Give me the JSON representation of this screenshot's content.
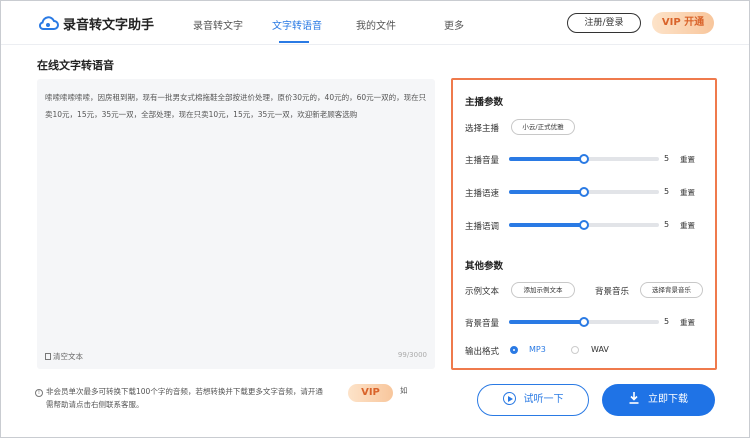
{
  "header": {
    "app_title": "录音转文字助手",
    "nav": [
      {
        "label": "录音转文字",
        "active": false
      },
      {
        "label": "文字转语音",
        "active": true
      },
      {
        "label": "我的文件",
        "active": false
      },
      {
        "label": "更多",
        "active": false
      }
    ],
    "login_label": "注册/登录",
    "vip_label": "VIP 开通"
  },
  "editor": {
    "section_title": "在线文字转语音",
    "text": "嗦嗦嗦嗦嗦嗦，因房租到期，现有一批男女式棉拖鞋全部按进价处理，原价30元的，40元的，60元一双的，现在只卖10元，15元，35元一双，全部处理，现在只卖10元，15元，35元一双，欢迎新老顾客选购",
    "clear_label": "清空文本",
    "char_count": "99/3000"
  },
  "notice": {
    "text": "非会员单次最多可转换下载100个字的音频，若想转换并下载更多文字音频，请开通",
    "vip_label": "VIP",
    "tail_1": "如",
    "line2": "需帮助请点击右侧联系客服。"
  },
  "panel": {
    "anchor_heading": "主播参数",
    "select_anchor_label": "选择主播",
    "anchor_value": "小云/正式优雅",
    "sliders": [
      {
        "label": "主播音量",
        "value": "5",
        "fill": 0.5,
        "reset": "重置"
      },
      {
        "label": "主播语速",
        "value": "5",
        "fill": 0.5,
        "reset": "重置"
      },
      {
        "label": "主播语调",
        "value": "5",
        "fill": 0.5,
        "reset": "重置"
      }
    ],
    "other_heading": "其他参数",
    "sample_text_label": "示例文本",
    "sample_text_btn": "添加示例文本",
    "bgm_label": "背景音乐",
    "bgm_btn": "选择背景音乐",
    "bg_volume": {
      "label": "背景音量",
      "value": "5",
      "fill": 0.5,
      "reset": "重置"
    },
    "format_label": "输出格式",
    "formats": [
      {
        "label": "MP3",
        "selected": true
      },
      {
        "label": "WAV",
        "selected": false
      }
    ]
  },
  "actions": {
    "preview_label": "试听一下",
    "download_label": "立即下载"
  },
  "colors": {
    "accent": "#2a7ae4",
    "panel_border": "#ef7a4c",
    "vip_text": "#d9632a"
  }
}
